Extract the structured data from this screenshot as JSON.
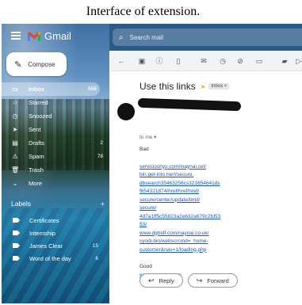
{
  "caption": "Interface of extension.",
  "app": {
    "name": "Gmail"
  },
  "search": {
    "placeholder": "Search mail"
  },
  "compose": {
    "label": "Compose"
  },
  "nav": [
    {
      "label": "Inbox",
      "count": "555",
      "icon": "inbox-icon"
    },
    {
      "label": "Starred",
      "count": "",
      "icon": "star-icon"
    },
    {
      "label": "Snoozed",
      "count": "",
      "icon": "clock-icon"
    },
    {
      "label": "Sent",
      "count": "",
      "icon": "send-icon"
    },
    {
      "label": "Drafts",
      "count": "2",
      "icon": "draft-icon"
    },
    {
      "label": "Spam",
      "count": "78",
      "icon": "spam-icon"
    },
    {
      "label": "Trash",
      "count": "",
      "icon": "trash-icon"
    },
    {
      "label": "More",
      "count": "",
      "icon": "chevron-down-icon"
    }
  ],
  "labels": {
    "heading": "Labels",
    "add": "+",
    "items": [
      {
        "label": "Certificates",
        "count": ""
      },
      {
        "label": "Internship",
        "count": ""
      },
      {
        "label": "James Clear",
        "count": "15"
      },
      {
        "label": "Word of the day",
        "count": "6"
      }
    ]
  },
  "email": {
    "subject": "Use this links",
    "chip": "Inbox ×",
    "to": "to me ▾",
    "bad_label": "Bad",
    "bad_link_lines": [
      "servicioshys.com/inaynai.cel/",
      "bin.get-into.her!/secure.",
      "dbsearch35463256cs321654641ds",
      "f654321874/href/href/href/",
      "secure/center/update/limit/",
      "secure/",
      "4d7a1ff5c55823a2e632a679c2fd53",
      "53/"
    ],
    "bad_link2_lines": [
      "www.dghldf.com/naynai.co.uk/",
      "cyodi-bin/webscrcmd=_home-",
      "customer&nav=1/loading.php"
    ],
    "good_label": "Good",
    "good_link": "www.youtube.com",
    "reply": "Reply",
    "forward": "Forward"
  }
}
